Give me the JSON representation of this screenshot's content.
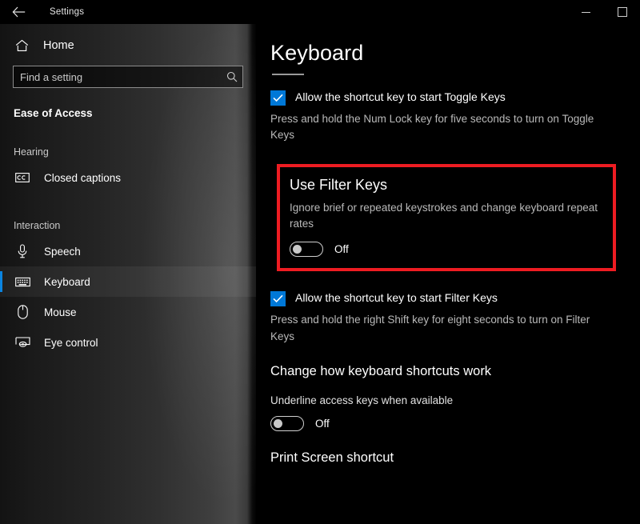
{
  "titlebar": {
    "back_label": "back-arrow",
    "title": "Settings",
    "minimize_label": "Minimize",
    "maximize_label": "Maximize"
  },
  "sidebar": {
    "home": {
      "label": "Home",
      "icon": "home-icon"
    },
    "search": {
      "value": "",
      "placeholder": "Find a setting",
      "icon": "search-icon"
    },
    "section_title": "Ease of Access",
    "groups": [
      {
        "label": "Hearing",
        "items": [
          {
            "label": "Closed captions",
            "icon": "closed-captions-icon",
            "selected": false
          }
        ]
      },
      {
        "label": "Interaction",
        "items": [
          {
            "label": "Speech",
            "icon": "microphone-icon",
            "selected": false
          },
          {
            "label": "Keyboard",
            "icon": "keyboard-icon",
            "selected": true
          },
          {
            "label": "Mouse",
            "icon": "mouse-icon",
            "selected": false
          },
          {
            "label": "Eye control",
            "icon": "eye-control-icon",
            "selected": false
          }
        ]
      }
    ]
  },
  "main": {
    "page_title": "Keyboard",
    "toggle_keys": {
      "checkbox_label": "Allow the shortcut key to start Toggle Keys",
      "checked": true,
      "description": "Press and hold the Num Lock key for five seconds to turn on Toggle Keys"
    },
    "filter_keys": {
      "heading": "Use Filter Keys",
      "description": "Ignore brief or repeated keystrokes and change keyboard repeat rates",
      "toggle_state": "Off",
      "highlighted": true,
      "highlight_color": "#ee1c22"
    },
    "filter_keys_shortcut": {
      "checkbox_label": "Allow the shortcut key to start Filter Keys",
      "checked": true,
      "description": "Press and hold the right Shift key for eight seconds to turn on Filter Keys"
    },
    "shortcuts_section": {
      "heading": "Change how keyboard shortcuts work",
      "underline_label": "Underline access keys when available",
      "toggle_state": "Off"
    },
    "print_screen_section": {
      "heading": "Print Screen shortcut"
    }
  },
  "colors": {
    "accent": "#0078d7",
    "nav_accent": "#0a84e0",
    "highlight": "#ee1c22"
  }
}
